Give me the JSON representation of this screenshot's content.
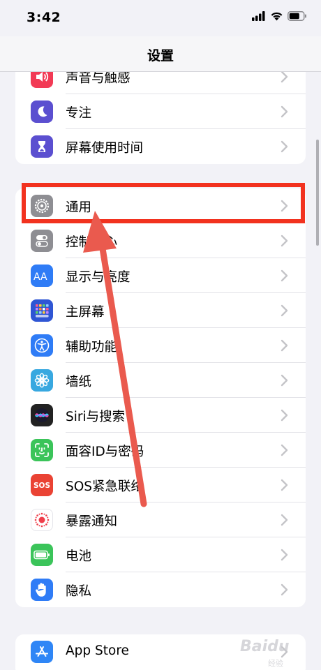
{
  "status": {
    "time": "3:42"
  },
  "nav": {
    "title": "设置"
  },
  "group1": [
    {
      "label": "声音与触感",
      "icon": "speaker-icon",
      "color": "#f23a55"
    },
    {
      "label": "专注",
      "icon": "moon-icon",
      "color": "#5b4fd0"
    },
    {
      "label": "屏幕使用时间",
      "icon": "hourglass-icon",
      "color": "#5b4fd0"
    }
  ],
  "group2": [
    {
      "label": "通用",
      "icon": "gear-icon",
      "color": "#8e8e93"
    },
    {
      "label": "控制中心",
      "icon": "toggles-icon",
      "color": "#8e8e93"
    },
    {
      "label": "显示与亮度",
      "icon": "text-size-icon",
      "color": "#2f7cf6"
    },
    {
      "label": "主屏幕",
      "icon": "home-grid-icon",
      "color": "#2f56d4"
    },
    {
      "label": "辅助功能",
      "icon": "accessibility-icon",
      "color": "#2f7cf6"
    },
    {
      "label": "墙纸",
      "icon": "flower-icon",
      "color": "#38a8e0"
    },
    {
      "label": "Siri与搜索",
      "icon": "siri-icon",
      "color": "#222222"
    },
    {
      "label": "面容ID与密码",
      "icon": "face-id-icon",
      "color": "#3bc45a"
    },
    {
      "label": "SOS紧急联络",
      "icon": "sos-icon",
      "color": "#ea4334"
    },
    {
      "label": "暴露通知",
      "icon": "exposure-icon",
      "color": "#ffffff"
    },
    {
      "label": "电池",
      "icon": "battery-icon",
      "color": "#3bc45a"
    },
    {
      "label": "隐私",
      "icon": "hand-icon",
      "color": "#2f7cf6"
    }
  ],
  "group3": [
    {
      "label": "App Store",
      "icon": "app-store-icon",
      "color": "#2f86f6"
    }
  ],
  "watermark": {
    "text": "Baidu",
    "sub": "经验"
  }
}
